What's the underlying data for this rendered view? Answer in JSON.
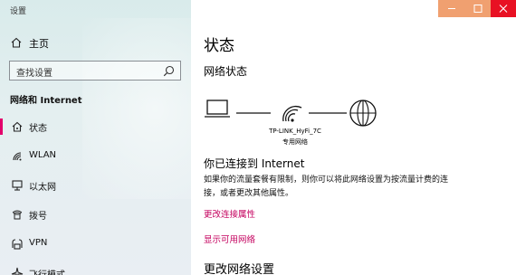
{
  "window": {
    "title": "设置"
  },
  "sidebar": {
    "home_label": "主页",
    "search_placeholder": "查找设置",
    "section_title": "网络和 Internet",
    "items": [
      {
        "label": "状态",
        "icon": "home-network-icon",
        "active": true
      },
      {
        "label": "WLAN",
        "icon": "wifi-icon"
      },
      {
        "label": "以太网",
        "icon": "ethernet-icon"
      },
      {
        "label": "拨号",
        "icon": "dialup-icon"
      },
      {
        "label": "VPN",
        "icon": "vpn-icon"
      },
      {
        "label": "飞行模式",
        "icon": "airplane-icon"
      }
    ]
  },
  "main": {
    "title": "状态",
    "network_status_heading": "网络状态",
    "ssid": "TP-LINK_HyFi_7C",
    "network_type": "专用网络",
    "connected_heading": "你已连接到 Internet",
    "description": "如果你的流量套餐有限制，则你可以将此网络设置为按流量计费的连接，或者更改其他属性。",
    "link_change_props": "更改连接属性",
    "link_show_networks": "显示可用网络",
    "bottom_heading": "更改网络设置"
  },
  "colors": {
    "accent": "#c4005e",
    "close": "#e81123"
  }
}
